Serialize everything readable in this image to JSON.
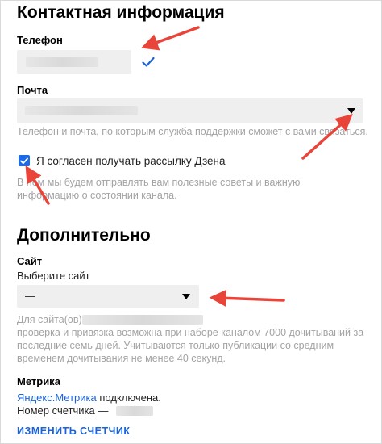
{
  "sections": {
    "contact_title": "Контактная информация",
    "extra_title": "Дополнительно"
  },
  "phone": {
    "label": "Телефон"
  },
  "mail": {
    "label": "Почта",
    "hint": "Телефон и почта, по которым служба поддержки сможет с вами связаться."
  },
  "newsletter": {
    "checkbox_label": "Я согласен получать рассылку Дзена",
    "checked": true,
    "hint": "В нём мы будем отправлять вам полезные советы и важную информацию о состоянии канала."
  },
  "site": {
    "label": "Сайт",
    "sublabel": "Выберите сайт",
    "selected": "—",
    "hint_prefix": "Для сайта(ов)",
    "hint_rest": "проверка и привязка возможна при наборе каналом 7000 дочитываний за последние семь дней. Учитываются только публикации со средним временем дочитывания не менее 40 секунд."
  },
  "metrika": {
    "label": "Метрика",
    "link": "Яндекс.Метрика",
    "status_suffix": " подключена.",
    "counter_label": "Номер счетчика —",
    "change_button": "ИЗМЕНИТЬ СЧЕТЧИК"
  },
  "colors": {
    "accent": "#1a63d8",
    "checkbox": "#1b6ae8",
    "arrow": "#e8443a",
    "field_bg": "#efefef"
  }
}
